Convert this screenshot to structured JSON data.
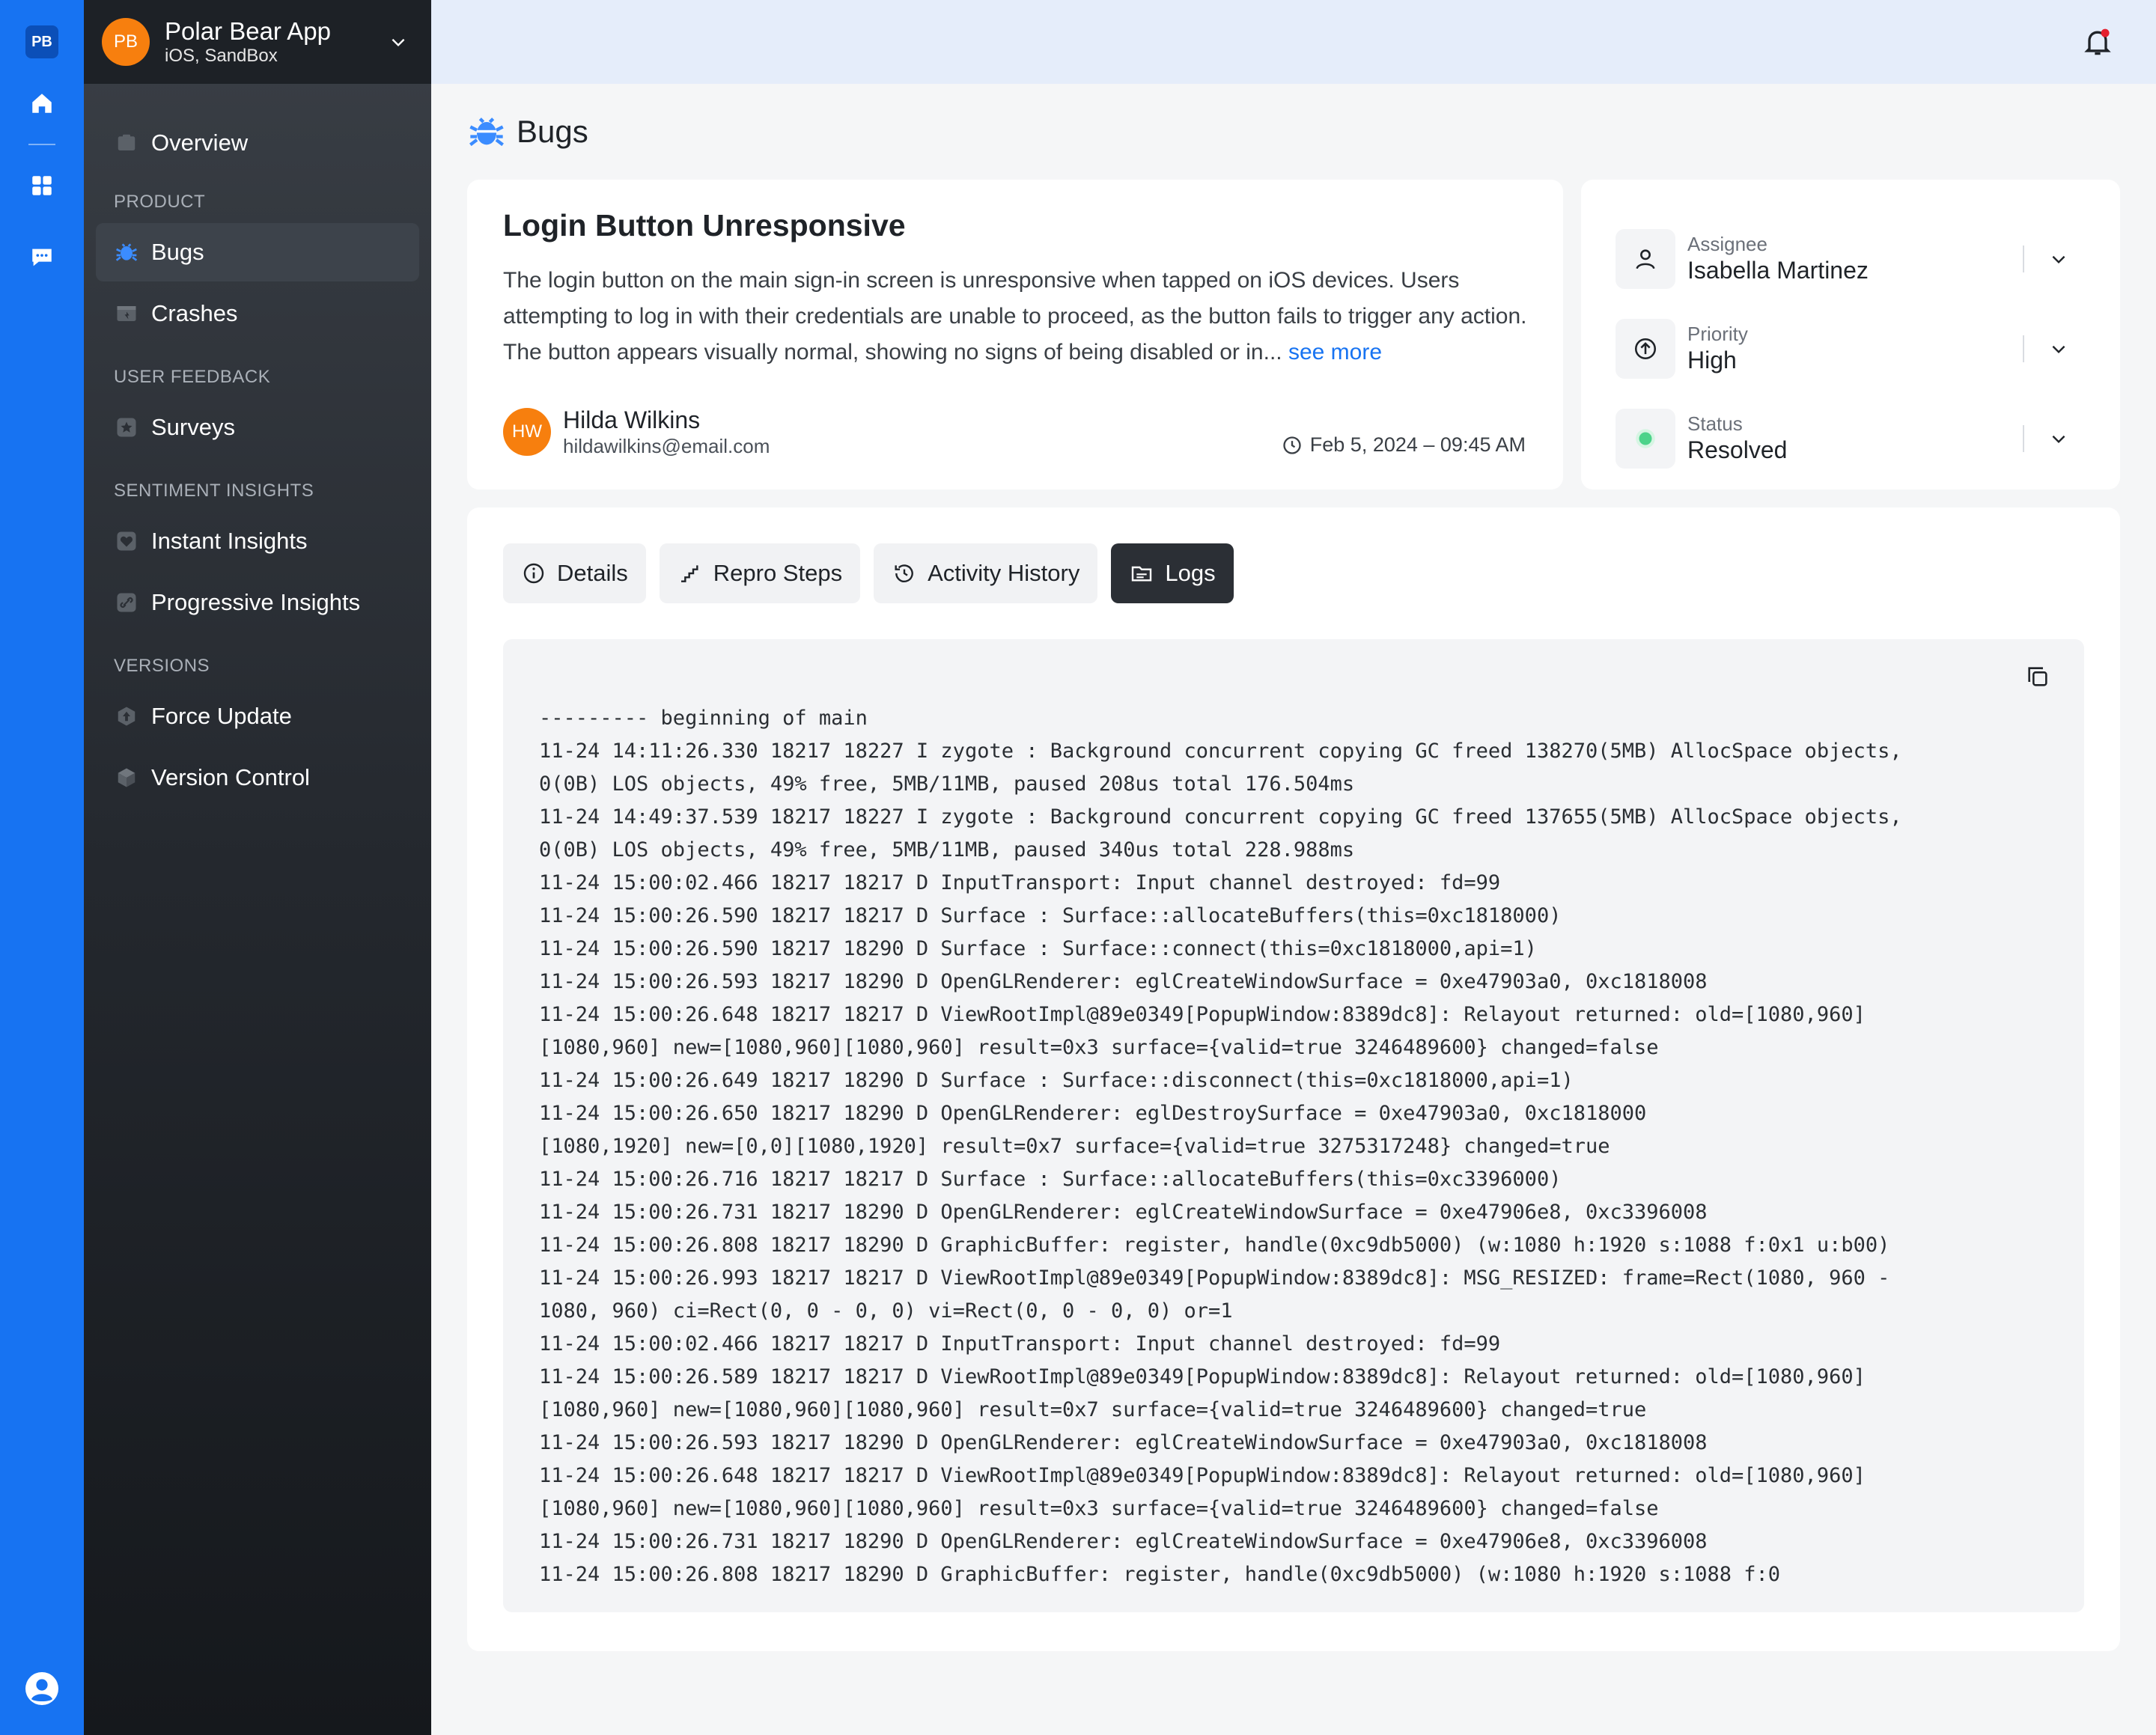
{
  "rail": {
    "logo": "PB",
    "icons": [
      "home-icon",
      "grid-icon",
      "chat-icon",
      "user-circle-icon"
    ]
  },
  "app": {
    "avatar": "PB",
    "name": "Polar Bear App",
    "env": "iOS, SandBox"
  },
  "nav": {
    "overview": "Overview",
    "group_product": "PRODUCT",
    "bugs": "Bugs",
    "crashes": "Crashes",
    "group_feedback": "USER FEEDBACK",
    "surveys": "Surveys",
    "group_sentiment": "SENTIMENT INSIGHTS",
    "instant": "Instant Insights",
    "progressive": "Progressive Insights",
    "group_versions": "VERSIONS",
    "force_update": "Force Update",
    "version_control": "Version Control"
  },
  "page": {
    "title": "Bugs"
  },
  "bug": {
    "title": "Login Button Unresponsive",
    "description": "The login button on the main sign-in screen is unresponsive when tapped on iOS devices. Users attempting to log in with their credentials are unable to proceed, as the button fails to trigger any action. The button appears visually normal, showing no signs of being disabled or in...",
    "see_more": "see more",
    "reporter": {
      "initials": "HW",
      "name": "Hilda Wilkins",
      "email": "hildawilkins@email.com"
    },
    "date": "Feb 5, 2024 – 09:45 AM"
  },
  "meta": {
    "assignee_label": "Assignee",
    "assignee": "Isabella Martinez",
    "priority_label": "Priority",
    "priority": "High",
    "status_label": "Status",
    "status": "Resolved",
    "status_color": "#4cd38a"
  },
  "tabs": {
    "details": "Details",
    "repro": "Repro Steps",
    "activity": "Activity History",
    "logs": "Logs"
  },
  "logs": [
    "--------- beginning of main",
    "11-24 14:11:26.330 18217 18227 I zygote : Background concurrent copying GC freed 138270(5MB) AllocSpace objects,",
    "0(0B) LOS objects, 49% free, 5MB/11MB, paused 208us total 176.504ms",
    "11-24 14:49:37.539 18217 18227 I zygote : Background concurrent copying GC freed 137655(5MB) AllocSpace objects,",
    "0(0B) LOS objects, 49% free, 5MB/11MB, paused 340us total 228.988ms",
    "11-24 15:00:02.466 18217 18217 D InputTransport: Input channel destroyed: fd=99",
    "11-24 15:00:26.590 18217 18217 D Surface : Surface::allocateBuffers(this=0xc1818000)",
    "11-24 15:00:26.590 18217 18290 D Surface : Surface::connect(this=0xc1818000,api=1)",
    "11-24 15:00:26.593 18217 18290 D OpenGLRenderer: eglCreateWindowSurface = 0xe47903a0, 0xc1818008",
    "11-24 15:00:26.648 18217 18217 D ViewRootImpl@89e0349[PopupWindow:8389dc8]: Relayout returned: old=[1080,960]",
    "[1080,960] new=[1080,960][1080,960] result=0x3 surface={valid=true 3246489600} changed=false",
    "11-24 15:00:26.649 18217 18290 D Surface : Surface::disconnect(this=0xc1818000,api=1)",
    "11-24 15:00:26.650 18217 18290 D OpenGLRenderer: eglDestroySurface = 0xe47903a0, 0xc1818000",
    "[1080,1920] new=[0,0][1080,1920] result=0x7 surface={valid=true 3275317248} changed=true",
    "11-24 15:00:26.716 18217 18217 D Surface : Surface::allocateBuffers(this=0xc3396000)",
    "11-24 15:00:26.731 18217 18290 D OpenGLRenderer: eglCreateWindowSurface = 0xe47906e8, 0xc3396008",
    "11-24 15:00:26.808 18217 18290 D GraphicBuffer: register, handle(0xc9db5000) (w:1080 h:1920 s:1088 f:0x1 u:b00)",
    "11-24 15:00:26.993 18217 18217 D ViewRootImpl@89e0349[PopupWindow:8389dc8]: MSG_RESIZED: frame=Rect(1080, 960 -",
    "1080, 960) ci=Rect(0, 0 - 0, 0) vi=Rect(0, 0 - 0, 0) or=1",
    "11-24 15:00:02.466 18217 18217 D InputTransport: Input channel destroyed: fd=99",
    "11-24 15:00:26.589 18217 18217 D ViewRootImpl@89e0349[PopupWindow:8389dc8]: Relayout returned: old=[1080,960]",
    "[1080,960] new=[1080,960][1080,960] result=0x7 surface={valid=true 3246489600} changed=true",
    "11-24 15:00:26.593 18217 18290 D OpenGLRenderer: eglCreateWindowSurface = 0xe47903a0, 0xc1818008",
    "11-24 15:00:26.648 18217 18217 D ViewRootImpl@89e0349[PopupWindow:8389dc8]: Relayout returned: old=[1080,960]",
    "[1080,960] new=[1080,960][1080,960] result=0x3 surface={valid=true 3246489600} changed=false",
    "11-24 15:00:26.731 18217 18290 D OpenGLRenderer: eglCreateWindowSurface = 0xe47906e8, 0xc3396008",
    "11-24 15:00:26.808 18217 18290 D GraphicBuffer: register, handle(0xc9db5000) (w:1080 h:1920 s:1088 f:0"
  ]
}
